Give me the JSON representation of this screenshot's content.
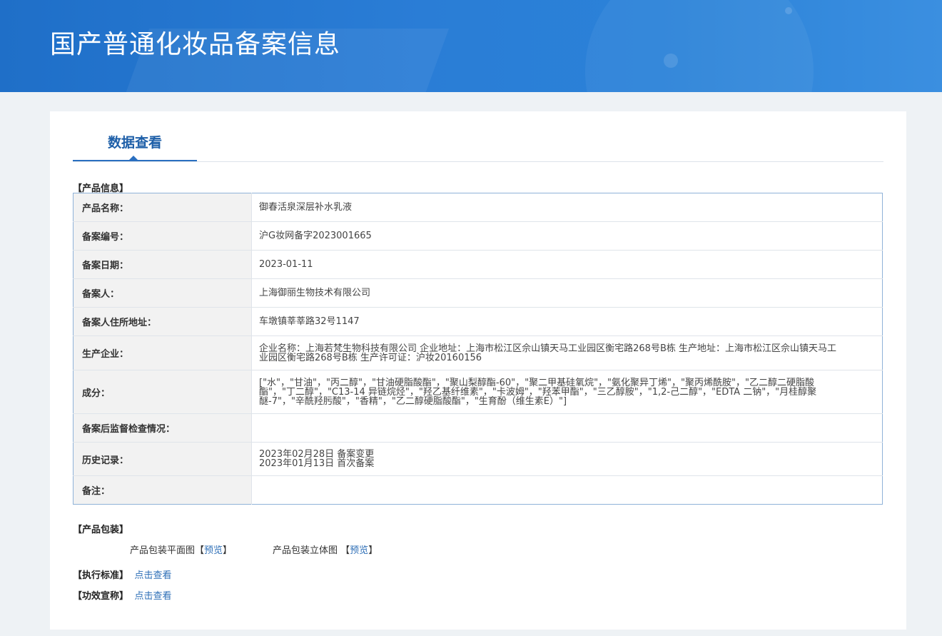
{
  "header": {
    "title": "国产普通化妆品备案信息"
  },
  "tabs": [
    {
      "label": "数据查看"
    }
  ],
  "product_info": {
    "section_title": "【产品信息】",
    "rows": [
      {
        "key": "产品名称：",
        "value": "御春活泉深层补水乳液"
      },
      {
        "key": "备案编号：",
        "value": "沪G妆网备字2023001665"
      },
      {
        "key": "备案日期：",
        "value": "2023-01-11"
      },
      {
        "key": "备案人：",
        "value": "上海御丽生物技术有限公司"
      },
      {
        "key": "备案人住所地址：",
        "value": "车墩镇莘莘路32号1147"
      },
      {
        "key": "生产企业：",
        "value": "企业名称：上海若梵生物科技有限公司 企业地址：上海市松江区佘山镇天马工业园区衡宅路268号B栋 生产地址：上海市松江区佘山镇天马工业园区衡宅路268号B栋 生产许可证：沪妆20160156"
      },
      {
        "key": "成分：",
        "value": "[\"水\"，\"甘油\"，\"丙二醇\"，\"甘油硬脂酸酯\"，\"聚山梨醇酯-60\"，\"聚二甲基硅氧烷\"，\"氨化聚异丁烯\"，\"聚丙烯酰胺\"，\"乙二醇二硬脂酸酯\"，\"丁二醇\"，\"C13-14 异链烷烃\"，\"羟乙基纤维素\"，\"卡波姆\"，\"羟苯甲酯\"，\"三乙醇胺\"，\"1,2-己二醇\"，\"EDTA 二钠\"，\"月桂醇聚醚-7\"，\"辛酰羟肟酸\"，\"香精\"，\"乙二醇硬脂酸酯\"，\"生育酚（维生素E）\"]"
      },
      {
        "key": "备案后监督检查情况：",
        "value": ""
      },
      {
        "key": "历史记录：",
        "value_lines": [
          "2023年02月28日 备案变更",
          "2023年01月13日 首次备案"
        ]
      },
      {
        "key": "备注：",
        "value": ""
      }
    ]
  },
  "packaging": {
    "section_title": "【产品包装】",
    "flat_label": "产品包装平面图",
    "stereo_label": "产品包装立体图",
    "preview_link": "预览",
    "bracket_open": "【",
    "bracket_close": "】"
  },
  "standard": {
    "section_title": "【执行标准】",
    "link": "点击查看"
  },
  "efficacy": {
    "section_title": "【功效宣称】",
    "link": "点击查看"
  }
}
